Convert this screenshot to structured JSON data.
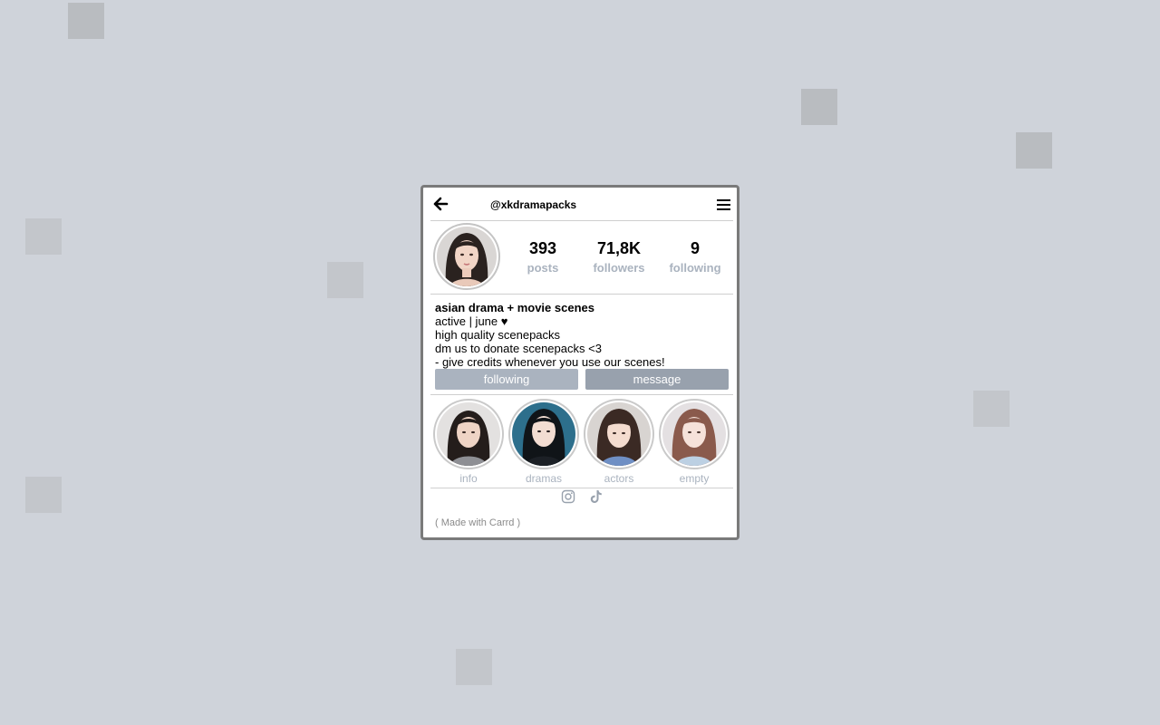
{
  "profile": {
    "handle": "@xkdramapacks",
    "stats": [
      {
        "value": "393",
        "label": "posts"
      },
      {
        "value": "71,8K",
        "label": "followers"
      },
      {
        "value": "9",
        "label": "following"
      }
    ],
    "bio": {
      "title": "asian drama + movie scenes",
      "lines": [
        "active | june ♥",
        "high quality scenepacks",
        "dm us to donate scenepacks <3",
        "- give credits whenever you use our scenes!"
      ]
    },
    "buttons": {
      "following": "following",
      "message": "message"
    },
    "highlights": [
      {
        "label": "info"
      },
      {
        "label": "dramas"
      },
      {
        "label": "actors"
      },
      {
        "label": "empty"
      }
    ],
    "socials": [
      "instagram-icon",
      "tiktok-icon"
    ],
    "footer": "( Made with Carrd )"
  },
  "colors": {
    "page_background": "#cfd3da",
    "muted_label": "#aab3bf",
    "following_button": "#aab3bf",
    "message_button": "#98a1ad"
  }
}
